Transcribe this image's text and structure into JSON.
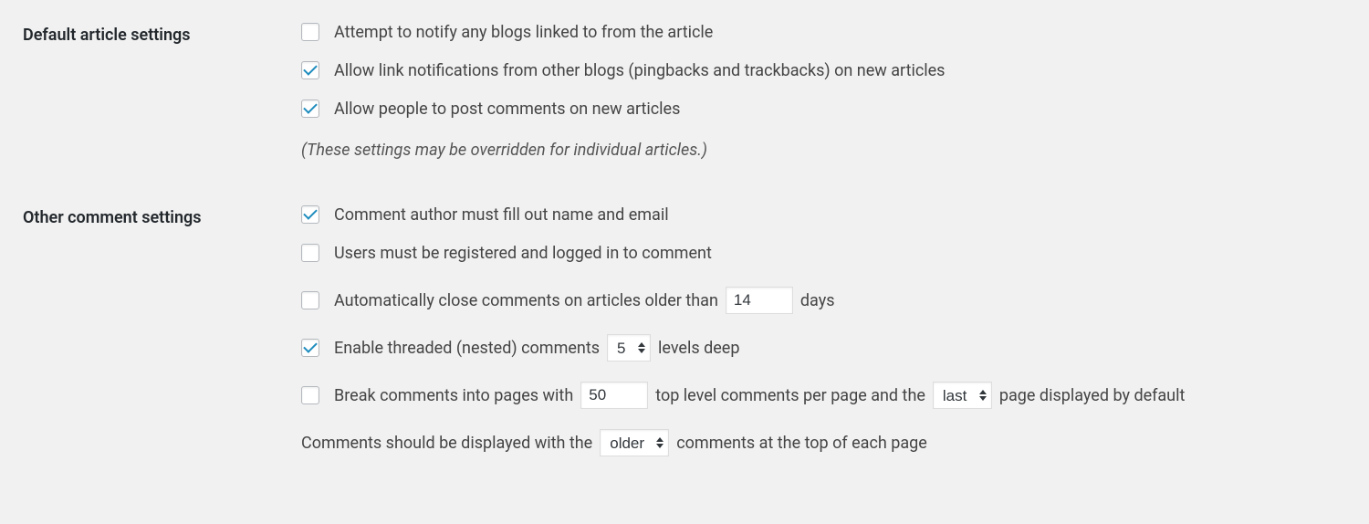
{
  "defaultArticle": {
    "heading": "Default article settings",
    "notifyLinked": {
      "checked": false,
      "label": "Attempt to notify any blogs linked to from the article"
    },
    "allowPingbacks": {
      "checked": true,
      "label": "Allow link notifications from other blogs (pingbacks and trackbacks) on new articles"
    },
    "allowComments": {
      "checked": true,
      "label": "Allow people to post comments on new articles"
    },
    "note": "(These settings may be overridden for individual articles.)"
  },
  "otherComment": {
    "heading": "Other comment settings",
    "mustFillNameEmail": {
      "checked": true,
      "label": "Comment author must fill out name and email"
    },
    "mustBeRegistered": {
      "checked": false,
      "label": "Users must be registered and logged in to comment"
    },
    "autoClose": {
      "checked": false,
      "labelPre": "Automatically close comments on articles older than",
      "daysValue": "14",
      "labelPost": "days"
    },
    "threaded": {
      "checked": true,
      "labelPre": "Enable threaded (nested) comments",
      "levelsValue": "5",
      "labelPost": "levels deep"
    },
    "paginate": {
      "checked": false,
      "labelPre": "Break comments into pages with",
      "perPageValue": "50",
      "labelMid": "top level comments per page and the",
      "defaultPageValue": "last",
      "labelPost": "page displayed by default"
    },
    "commentOrder": {
      "labelPre": "Comments should be displayed with the",
      "orderValue": "older",
      "labelPost": "comments at the top of each page"
    }
  }
}
